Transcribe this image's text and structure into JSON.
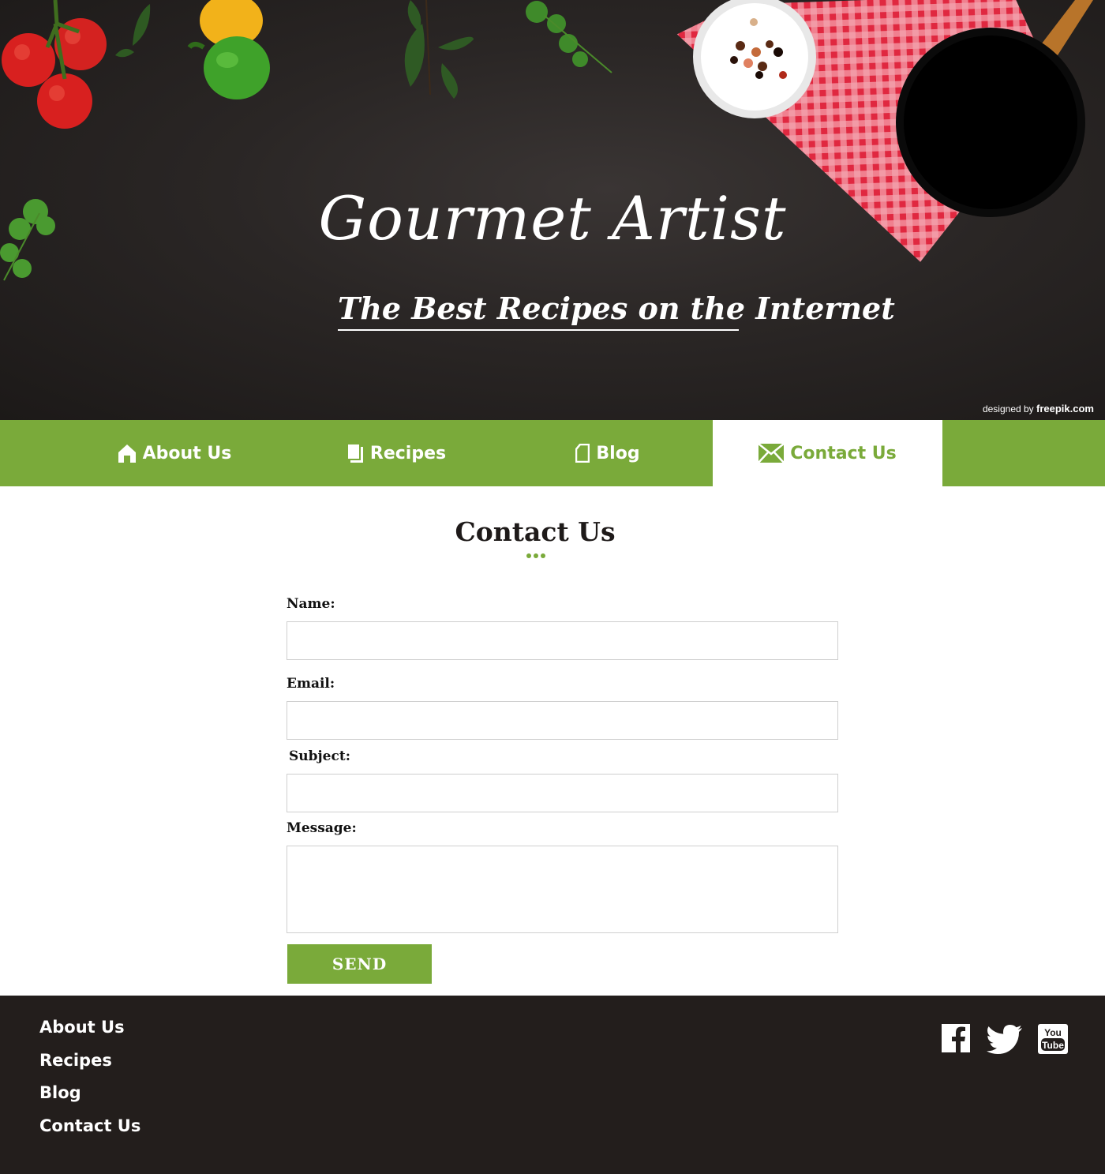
{
  "hero": {
    "title": "Gourmet Artist",
    "tagline": "The Best Recipes on the Internet",
    "credit_prefix": "designed by",
    "credit_brand": "freepik.com"
  },
  "nav": {
    "items": [
      {
        "label": "About Us",
        "icon": "home-icon"
      },
      {
        "label": "Recipes",
        "icon": "pages-icon"
      },
      {
        "label": "Blog",
        "icon": "document-icon"
      },
      {
        "label": "Contact Us",
        "icon": "envelope-icon",
        "active": true
      }
    ]
  },
  "main": {
    "title": "Contact Us",
    "form": {
      "name_label": "Name:",
      "email_label": "Email:",
      "subject_label": "Subject:",
      "message_label": "Message:",
      "name_value": "",
      "email_value": "",
      "subject_value": "",
      "message_value": "",
      "send_label": "SEND"
    }
  },
  "footer": {
    "links": [
      "About Us",
      "Recipes",
      "Blog",
      "Contact Us"
    ],
    "social": [
      "facebook-icon",
      "twitter-icon",
      "youtube-icon"
    ]
  },
  "colors": {
    "accent": "#7aaa3a",
    "hero_bg": "#2a2625",
    "footer_bg": "#231e1c",
    "text": "#1e1a19"
  }
}
